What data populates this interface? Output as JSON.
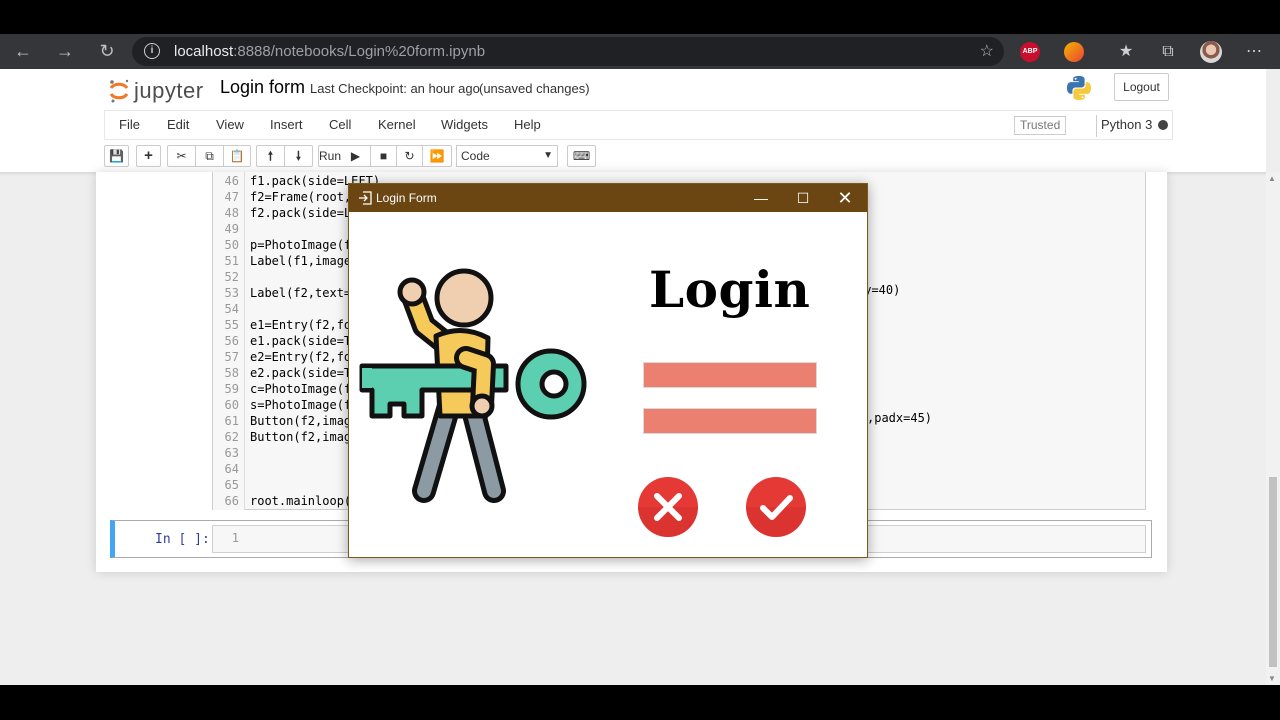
{
  "browser": {
    "url_host": "localhost",
    "url_path": ":8888/notebooks/Login%20form.ipynb",
    "ext_abp": "ABP"
  },
  "jupyter": {
    "logo_text": "jupyter",
    "notebook_title": "Login form",
    "checkpoint": "Last Checkpoint: an hour ago",
    "unsaved": "(unsaved changes)",
    "logout": "Logout",
    "menu": [
      "File",
      "Edit",
      "View",
      "Insert",
      "Cell",
      "Kernel",
      "Widgets",
      "Help"
    ],
    "trusted": "Trusted",
    "kernel": "Python 3",
    "run_label": "Run",
    "cell_type": "Code"
  },
  "code": {
    "lines": [
      {
        "no": "46",
        "text": "f1.pack(side=LEFT)"
      },
      {
        "no": "47",
        "text": "f2=Frame(root,"
      },
      {
        "no": "48",
        "text": "f2.pack(side=L"
      },
      {
        "no": "49",
        "text": ""
      },
      {
        "no": "50",
        "text": "p=PhotoImage(f"
      },
      {
        "no": "51",
        "text": "Label(f1,image"
      },
      {
        "no": "52",
        "text": ""
      },
      {
        "no": "53",
        "text": "Label(f2,text="
      },
      {
        "no": "54",
        "text": ""
      },
      {
        "no": "55",
        "text": "e1=Entry(f2,fo"
      },
      {
        "no": "56",
        "text": "e1.pack(side=T"
      },
      {
        "no": "57",
        "text": "e2=Entry(f2,fo"
      },
      {
        "no": "58",
        "text": "e2.pack(side=T"
      },
      {
        "no": "59",
        "text": "c=PhotoImage(f"
      },
      {
        "no": "60",
        "text": "s=PhotoImage(f"
      },
      {
        "no": "61",
        "text": "Button(f2,imag"
      },
      {
        "no": "62",
        "text": "Button(f2,imag"
      },
      {
        "no": "63",
        "text": ""
      },
      {
        "no": "64",
        "text": ""
      },
      {
        "no": "65",
        "text": ""
      },
      {
        "no": "66",
        "text": "root.mainloop("
      }
    ],
    "right_53": "dy=40)",
    "right_61": ",padx=45)"
  },
  "empty_cell": {
    "prompt": "In [ ]:",
    "line_no": "1"
  },
  "login_window": {
    "title": "Login Form",
    "heading": "Login",
    "colors": {
      "titlebar": "#6b4512",
      "entry": "#ec8070",
      "cancel": "#e53935",
      "ok": "#e53935",
      "key": "#5ccfb0"
    }
  }
}
